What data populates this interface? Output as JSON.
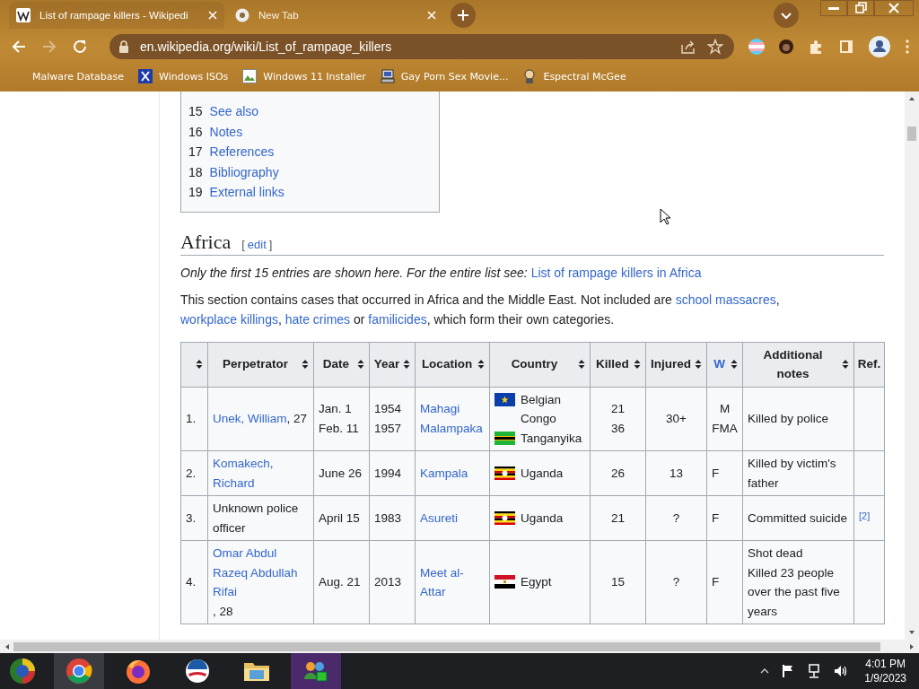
{
  "browser": {
    "tabs": [
      {
        "title": "List of rampage killers - Wikipedi",
        "selected": true
      },
      {
        "title": "New Tab",
        "selected": false
      }
    ],
    "forward_disabled": true,
    "address": "en.wikipedia.org/wiki/List_of_rampage_killers",
    "bookmarks": [
      {
        "label": "Malware Database"
      },
      {
        "label": "Windows ISOs"
      },
      {
        "label": "Windows 11 Installer"
      },
      {
        "label": "Gay Porn Sex Movie..."
      },
      {
        "label": "Espectral McGee"
      }
    ]
  },
  "toc": [
    {
      "number": "15",
      "label": "See also"
    },
    {
      "number": "16",
      "label": "Notes"
    },
    {
      "number": "17",
      "label": "References"
    },
    {
      "number": "18",
      "label": "Bibliography"
    },
    {
      "number": "19",
      "label": "External links"
    }
  ],
  "section": {
    "heading": "Africa",
    "edit_open": "[",
    "edit": "edit",
    "edit_close": "]",
    "hatnote": "Only the first 15 entries are shown here. For the entire list see:",
    "hatnote_link": "List of rampage killers in Africa",
    "intro": [
      {
        "text": "This section contains cases that occurred in Africa and the Middle East. Not included are ",
        "link": false
      },
      {
        "text": "school massacres",
        "link": true
      },
      {
        "text": ", ",
        "link": false
      },
      {
        "text": "workplace killings",
        "link": true
      },
      {
        "text": ", ",
        "link": false
      },
      {
        "text": "hate crimes",
        "link": true
      },
      {
        "text": " or ",
        "link": false
      },
      {
        "text": "familicides",
        "link": true
      },
      {
        "text": ", which form their own categories.",
        "link": false
      }
    ]
  },
  "table": {
    "columns": [
      {
        "sortable": true
      },
      {
        "label": "Perpetrator",
        "sortable": true,
        "link": false
      },
      {
        "label": "Date",
        "sortable": true,
        "link": false
      },
      {
        "label": "Year",
        "sortable": true,
        "link": false
      },
      {
        "label": "Location",
        "sortable": true,
        "link": false
      },
      {
        "label": "Country",
        "sortable": true,
        "link": false
      },
      {
        "label": "Killed",
        "sortable": true,
        "link": false
      },
      {
        "label": "Injured",
        "sortable": true,
        "link": false
      },
      {
        "label": "W",
        "sortable": true,
        "link": true
      },
      {
        "label": "Additional notes",
        "sortable": true,
        "link": false
      },
      {
        "label": "Ref.",
        "sortable": false,
        "link": false
      }
    ],
    "rows": [
      {
        "number": "1.",
        "perpetrator": [
          {
            "text": "Unek, William",
            "link": true
          },
          {
            "text": ", 27",
            "link": false
          }
        ],
        "date": [
          "Jan. 1",
          "Feb. 11"
        ],
        "year": [
          "1954",
          "1957"
        ],
        "location": [
          "Mahagi",
          "Malampaka"
        ],
        "country": [
          {
            "kind": "belgian_congo",
            "name": "Belgian Congo"
          },
          {
            "kind": "tanganyika",
            "name": "Tanganyika"
          }
        ],
        "killed": [
          "21",
          "36"
        ],
        "injured": "30+",
        "w": [
          "M",
          "FMA"
        ],
        "notes": [
          "Killed by police"
        ]
      },
      {
        "number": "2.",
        "perpetrator": [
          {
            "text": "Komakech, Richard",
            "link": true
          }
        ],
        "date": [
          "June 26"
        ],
        "year": [
          "1994"
        ],
        "location": [
          "Kampala"
        ],
        "country": [
          {
            "kind": "uganda",
            "name": "Uganda"
          }
        ],
        "killed": [
          "26"
        ],
        "injured": "13",
        "w": [
          "F"
        ],
        "notes": [
          "Killed by victim's father"
        ]
      },
      {
        "number": "3.",
        "perpetrator": [
          {
            "text": "Unknown police officer",
            "link": false
          }
        ],
        "date": [
          "April 15"
        ],
        "year": [
          "1983"
        ],
        "location": [
          "Asureti"
        ],
        "country": [
          {
            "kind": "uganda",
            "name": "Uganda"
          }
        ],
        "killed": [
          "21"
        ],
        "injured": "?",
        "w": [
          "F"
        ],
        "notes": [
          "Committed suicide"
        ],
        "ref": "[2]"
      },
      {
        "number": "4.",
        "perpetrator": [
          {
            "text": "Omar Abdul Razeq Abdullah Rifai",
            "link": true
          },
          {
            "text": ", 28",
            "link": false
          }
        ],
        "date": [
          "Aug. 21"
        ],
        "year": [
          "2013"
        ],
        "location": [
          "Meet al-Attar"
        ],
        "country": [
          {
            "kind": "egypt",
            "name": "Egypt"
          }
        ],
        "killed": [
          "15"
        ],
        "injured": "?",
        "w": [
          "F"
        ],
        "notes": [
          "Shot dead",
          "Killed 23 people over the past five years"
        ]
      }
    ]
  },
  "taskbar": {
    "apps": [
      {
        "kind": "chrome",
        "selected": true
      },
      {
        "kind": "firefox",
        "selected": false
      },
      {
        "kind": "campaign",
        "selected": false
      },
      {
        "kind": "folder",
        "selected": false
      },
      {
        "kind": "messenger",
        "selected": true
      }
    ],
    "time": "4:01 PM",
    "date": "1/9/2023"
  }
}
